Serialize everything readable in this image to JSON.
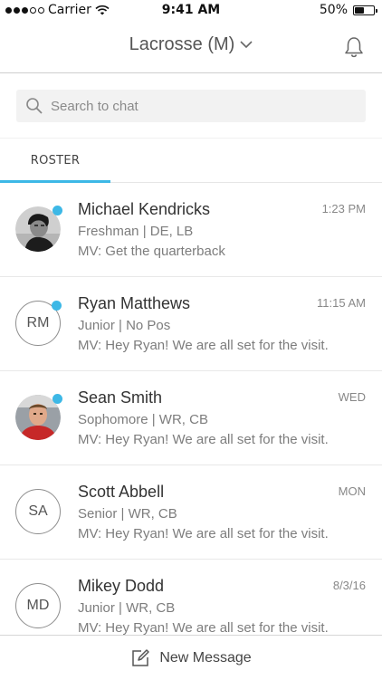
{
  "status_bar": {
    "carrier": "Carrier",
    "time": "9:41 AM",
    "battery": "50%",
    "battery_level": 0.5,
    "signal_bars_filled": 3,
    "signal_bars_total": 5
  },
  "header": {
    "title": "Lacrosse (M)",
    "dropdown_icon": "chevron-down-icon",
    "notifications_icon": "bell-icon"
  },
  "search": {
    "placeholder": "Search to chat",
    "icon": "search-icon"
  },
  "tabs": [
    {
      "label": "ROSTER",
      "active": true
    }
  ],
  "accent_color": "#3db8e6",
  "roster": [
    {
      "name": "Michael Kendricks",
      "subtitle": "Freshman | DE, LB",
      "preview": "MV: Get the quarterback",
      "time": "1:23 PM",
      "avatar_type": "photo",
      "initials": "",
      "online": true
    },
    {
      "name": "Ryan Matthews",
      "subtitle": "Junior | No Pos",
      "preview": "MV: Hey Ryan! We are all set for the visit.",
      "time": "11:15 AM",
      "avatar_type": "initials",
      "initials": "RM",
      "online": true
    },
    {
      "name": "Sean Smith",
      "subtitle": "Sophomore | WR, CB",
      "preview": "MV: Hey Ryan! We are all set for the visit.",
      "time": "WED",
      "avatar_type": "photo",
      "initials": "",
      "online": true
    },
    {
      "name": "Scott Abbell",
      "subtitle": "Senior | WR, CB",
      "preview": "MV: Hey Ryan! We are all set for the visit.",
      "time": "MON",
      "avatar_type": "initials",
      "initials": "SA",
      "online": false
    },
    {
      "name": "Mikey Dodd",
      "subtitle": "Junior | WR, CB",
      "preview": "MV: Hey Ryan! We are all set for the visit.",
      "time": "8/3/16",
      "avatar_type": "initials",
      "initials": "MD",
      "online": false
    }
  ],
  "bottom_bar": {
    "label": "New Message",
    "icon": "compose-icon"
  }
}
